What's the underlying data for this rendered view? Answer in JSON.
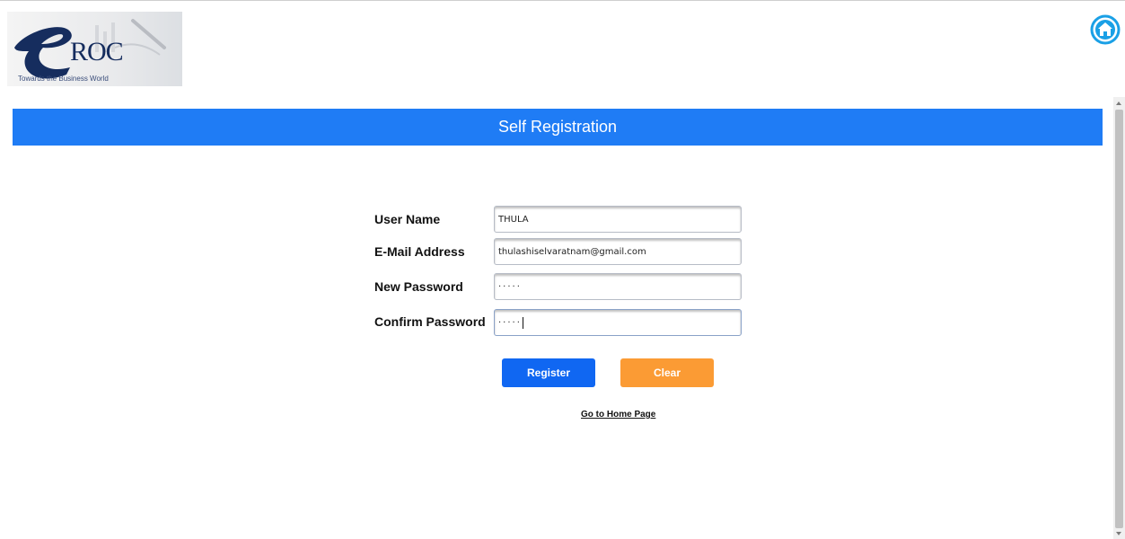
{
  "logo": {
    "brand": "ROC",
    "tagline": "Towards the Business World"
  },
  "header": {
    "title": "Self Registration"
  },
  "form": {
    "fields": [
      {
        "label": "User Name",
        "value": "THULA"
      },
      {
        "label": "E-Mail Address",
        "value": "thulashiselvaratnam@gmail.com"
      },
      {
        "label": "New Password",
        "value": "·····"
      },
      {
        "label": "Confirm Password",
        "value": "·····"
      }
    ],
    "register_label": "Register",
    "clear_label": "Clear",
    "home_link": "Go to Home Page"
  },
  "colors": {
    "header_bg": "#1f7cf5",
    "register_bg": "#1067f2",
    "clear_bg": "#fb9b34",
    "home_icon": "#1aa0e6"
  },
  "icons": {
    "home": "home-icon"
  }
}
